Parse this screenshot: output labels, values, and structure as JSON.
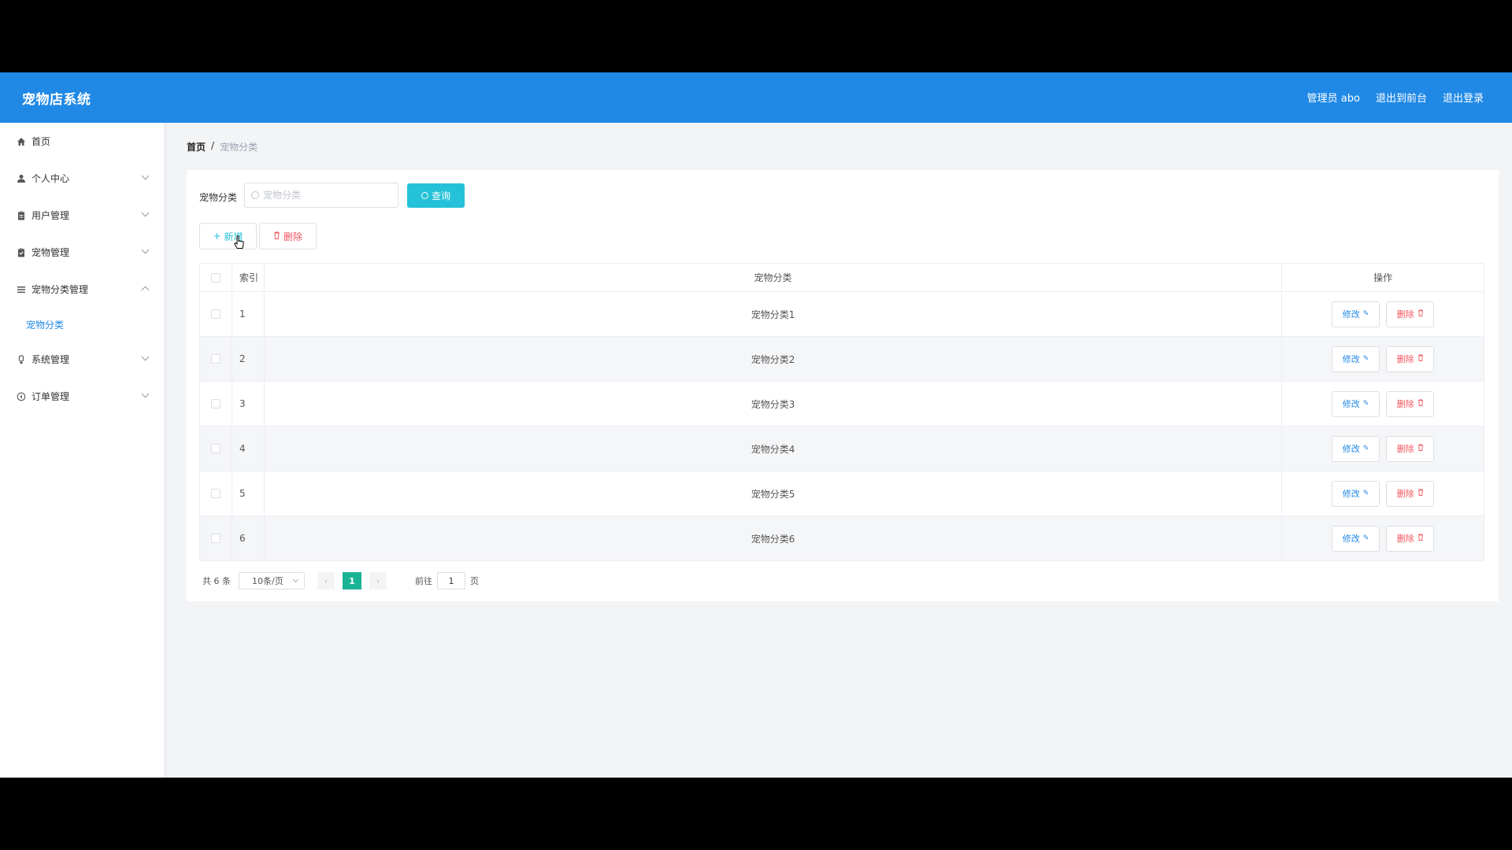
{
  "header": {
    "brand": "宠物店系统",
    "links": [
      "管理员 abo",
      "退出到前台",
      "退出登录"
    ]
  },
  "sidebar": {
    "items": [
      {
        "label": "首页",
        "icon": "home-icon",
        "chevron": "none"
      },
      {
        "label": "个人中心",
        "icon": "user-icon",
        "chevron": "down"
      },
      {
        "label": "用户管理",
        "icon": "clipboard-icon",
        "chevron": "down"
      },
      {
        "label": "宠物管理",
        "icon": "clipboard-check-icon",
        "chevron": "down"
      },
      {
        "label": "宠物分类管理",
        "icon": "list-icon",
        "chevron": "up"
      },
      {
        "label": "系统管理",
        "icon": "bulb-icon",
        "chevron": "down"
      },
      {
        "label": "订单管理",
        "icon": "compass-icon",
        "chevron": "down"
      }
    ],
    "active_sub": "宠物分类"
  },
  "breadcrumb": {
    "home": "首页",
    "sep": "/",
    "current": "宠物分类"
  },
  "search": {
    "label": "宠物分类",
    "placeholder": "宠物分类",
    "button": "查询"
  },
  "toolbar": {
    "add": "新增",
    "delete": "删除"
  },
  "table": {
    "headers": {
      "index": "索引",
      "name": "宠物分类",
      "ops": "操作"
    },
    "rows": [
      {
        "index": "1",
        "name": "宠物分类1"
      },
      {
        "index": "2",
        "name": "宠物分类2"
      },
      {
        "index": "3",
        "name": "宠物分类3"
      },
      {
        "index": "4",
        "name": "宠物分类4"
      },
      {
        "index": "5",
        "name": "宠物分类5"
      },
      {
        "index": "6",
        "name": "宠物分类6"
      }
    ],
    "edit_label": "修改",
    "delete_label": "删除"
  },
  "pager": {
    "total": "共 6 条",
    "page_size": "10条/页",
    "current_page": "1",
    "goto_prefix": "前往",
    "goto_value": "1",
    "goto_suffix": "页"
  },
  "colors": {
    "primary": "#2089e6",
    "accent": "#25c1d8",
    "danger": "#f0555e",
    "page_active": "#1ab394"
  }
}
